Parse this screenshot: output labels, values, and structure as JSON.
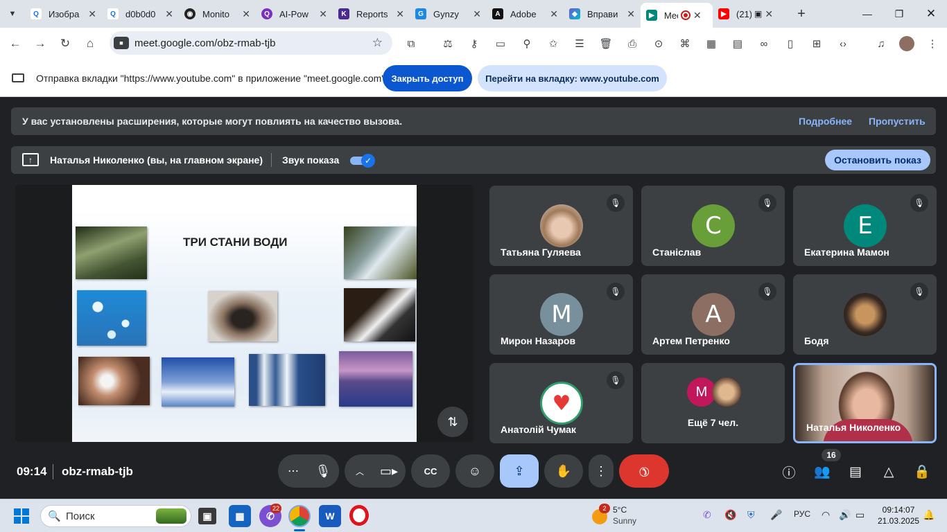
{
  "browser": {
    "tabs": [
      {
        "label": "Изобра",
        "icon": "search-icon",
        "color": "#1a73e8"
      },
      {
        "label": "d0b0d0",
        "icon": "search-icon",
        "color": "#1a73e8"
      },
      {
        "label": "Monito",
        "icon": "monitor-app-icon",
        "color": "#222222"
      },
      {
        "label": "AI-Pow",
        "icon": "ai-icon",
        "color": "#7b2fbf"
      },
      {
        "label": "Reports",
        "icon": "reports-icon",
        "color": "#4b2a8f"
      },
      {
        "label": "Gynzy",
        "icon": "gynzy-icon",
        "color": "#1e88e5"
      },
      {
        "label": "Adobe",
        "icon": "adobe-icon",
        "color": "#111111"
      },
      {
        "label": "Вправи",
        "icon": "exercise-icon",
        "color": "#6a5acd"
      },
      {
        "label": "Mee",
        "icon": "meet-icon",
        "color": "#00897b"
      },
      {
        "label": "(21)",
        "icon": "youtube-icon",
        "color": "#ff0000"
      }
    ],
    "url": "meet.google.com/obz-rmab-tjb"
  },
  "infobar": {
    "text": "Отправка вкладки \"https://www.youtube.com\" в приложение \"meet.google.com\"...",
    "close_access": "Закрыть доступ",
    "goto_tab": "Перейти на вкладку: www.youtube.com"
  },
  "notice": {
    "text": "У вас установлены расширения, которые могут повлиять на качество вызова.",
    "more": "Подробнее",
    "skip": "Пропустить"
  },
  "presenting": {
    "name": "Наталья Николенко (вы, на главном экране)",
    "sound": "Звук показа",
    "sound_on": true,
    "stop": "Остановить показ"
  },
  "slide": {
    "title": "ТРИ СТАНИ ВОДИ"
  },
  "participants": [
    {
      "name": "Татьяна Гуляева",
      "initial": "",
      "avatar": "photo-child",
      "color": "#c9a27e"
    },
    {
      "name": "Станіслав",
      "initial": "С",
      "avatar": "letter",
      "color": "#689f38"
    },
    {
      "name": "Екатерина Мамон",
      "initial": "Е",
      "avatar": "letter",
      "color": "#00897b"
    },
    {
      "name": "Мирон Назаров",
      "initial": "М",
      "avatar": "letter",
      "color": "#78909c"
    },
    {
      "name": "Артем Петренко",
      "initial": "А",
      "avatar": "letter",
      "color": "#8d6e63"
    },
    {
      "name": "Бодя",
      "initial": "",
      "avatar": "photo-dog-filter",
      "color": "#3a2a22"
    },
    {
      "name": "Анатолій Чумак",
      "initial": "",
      "avatar": "asmr-heart",
      "color": "#ffffff"
    },
    {
      "name": "Ещё 7 чел.",
      "initial": "М",
      "avatar": "more",
      "color": "#c2185b"
    },
    {
      "name": "Наталья Николенко",
      "initial": "",
      "avatar": "video",
      "color": "#6d5a4a"
    }
  ],
  "controls": {
    "time": "09:14",
    "code": "obz-rmab-tjb",
    "people_count": "16"
  },
  "taskbar": {
    "search": "Поиск",
    "viber_badge": "22",
    "weather_badge": "2",
    "temp": "5°C",
    "weather": "Sunny",
    "lang": "РУС",
    "time": "09:14:07",
    "date": "21.03.2025"
  }
}
